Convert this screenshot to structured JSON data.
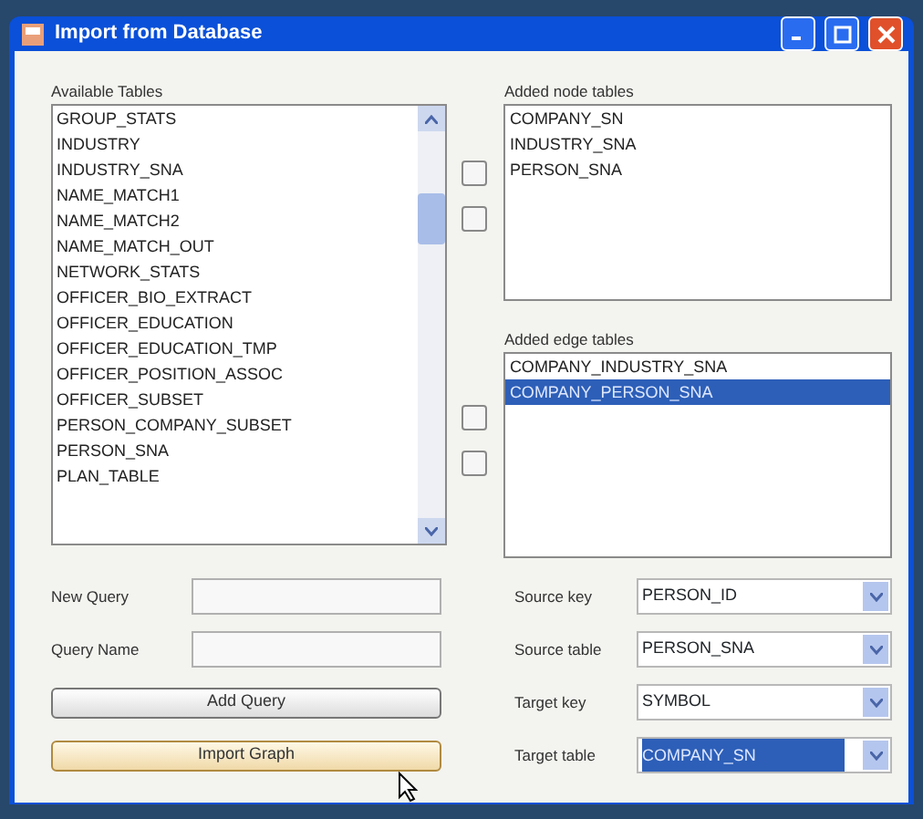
{
  "window": {
    "title": "Import from Database"
  },
  "available_tables": {
    "label": "Available Tables",
    "items": [
      {
        "text": "GROUP_STATS",
        "selected": false
      },
      {
        "text": "INDUSTRY",
        "selected": false
      },
      {
        "text": "INDUSTRY_SNA",
        "selected": false
      },
      {
        "text": "NAME_MATCH1",
        "selected": false
      },
      {
        "text": "NAME_MATCH2",
        "selected": false
      },
      {
        "text": "NAME_MATCH_OUT",
        "selected": false
      },
      {
        "text": "NETWORK_STATS",
        "selected": false
      },
      {
        "text": "OFFICER_BIO_EXTRACT",
        "selected": false
      },
      {
        "text": "OFFICER_EDUCATION",
        "selected": false
      },
      {
        "text": "OFFICER_EDUCATION_TMP",
        "selected": false
      },
      {
        "text": "OFFICER_POSITION_ASSOC",
        "selected": false
      },
      {
        "text": "OFFICER_SUBSET",
        "selected": false
      },
      {
        "text": "PERSON_COMPANY_SUBSET",
        "selected": false
      },
      {
        "text": "PERSON_SNA",
        "selected": false
      },
      {
        "text": "PLAN_TABLE",
        "selected": false
      }
    ]
  },
  "node_tables": {
    "label": "Added node tables",
    "items": [
      {
        "text": "COMPANY_SN",
        "selected": false
      },
      {
        "text": "INDUSTRY_SNA",
        "selected": false
      },
      {
        "text": "PERSON_SNA",
        "selected": false
      }
    ]
  },
  "edge_tables": {
    "label": "Added edge tables",
    "items": [
      {
        "text": "COMPANY_INDUSTRY_SNA",
        "selected": false
      },
      {
        "text": "COMPANY_PERSON_SNA",
        "selected": true
      }
    ]
  },
  "query_fields": [
    {
      "label": "New Query"
    },
    {
      "label": "Query Name"
    }
  ],
  "buttons": [
    {
      "label": "Add Query",
      "highlighted": false
    },
    {
      "label": "Import Graph",
      "highlighted": true
    }
  ],
  "key_fields": [
    {
      "label": "Source key",
      "value": "PERSON_ID",
      "selected": false
    },
    {
      "label": "Source table",
      "value": "PERSON_SNA",
      "selected": false
    },
    {
      "label": "Target key",
      "value": "SYMBOL",
      "selected": false
    },
    {
      "label": "Target table",
      "value": "COMPANY_SN",
      "selected": true
    }
  ]
}
